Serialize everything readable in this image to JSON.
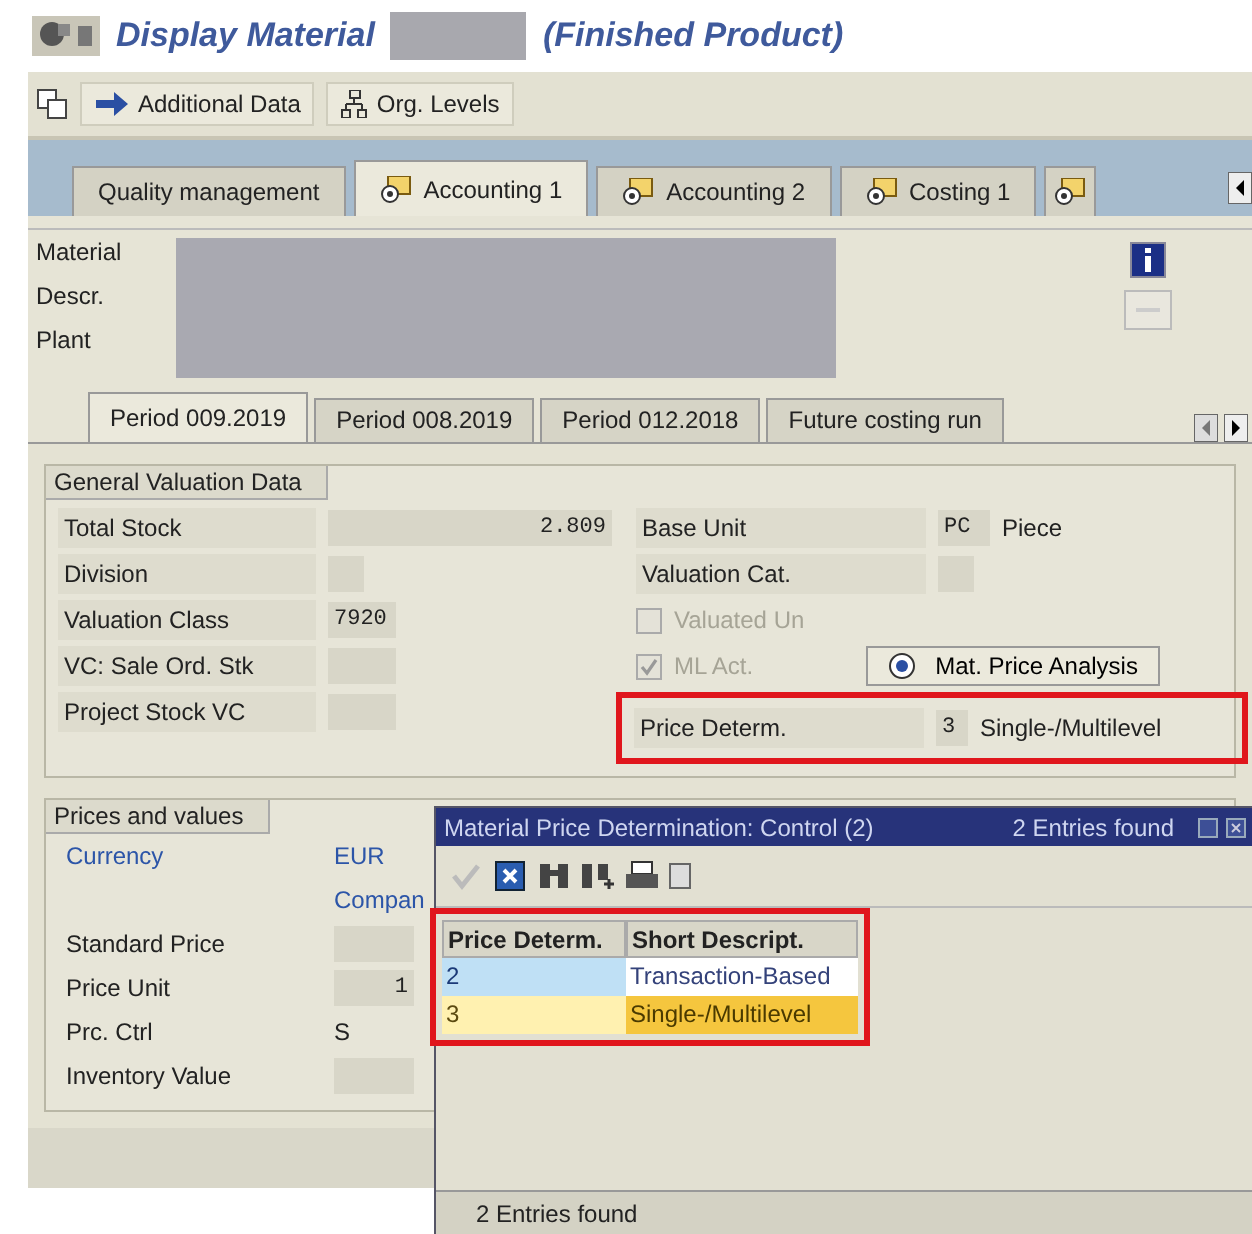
{
  "window": {
    "title_start": "Display Material",
    "title_end": "(Finished Product)"
  },
  "toolbar": {
    "buttons": [
      "Additional Data",
      "Org. Levels"
    ]
  },
  "tabs": [
    {
      "label": "Quality management",
      "selected": false,
      "icon": false
    },
    {
      "label": "Accounting 1",
      "selected": true,
      "icon": true
    },
    {
      "label": "Accounting 2",
      "selected": false,
      "icon": true
    },
    {
      "label": "Costing 1",
      "selected": false,
      "icon": true
    }
  ],
  "header": {
    "labels": [
      "Material",
      "Descr.",
      "Plant"
    ]
  },
  "period_tabs": [
    {
      "label": "Period 009.2019",
      "selected": true
    },
    {
      "label": "Period 008.2019",
      "selected": false
    },
    {
      "label": "Period 012.2018",
      "selected": false
    },
    {
      "label": "Future costing run",
      "selected": false
    }
  ],
  "general_valuation": {
    "title": "General Valuation Data",
    "left": [
      {
        "label": "Total Stock",
        "kind": "amount",
        "value": "2.809"
      },
      {
        "label": "Division",
        "kind": "code"
      },
      {
        "label": "Valuation Class",
        "kind": "wide_code",
        "value": "7920"
      },
      {
        "label": "VC: Sale Ord. Stk",
        "kind": "wide_code"
      },
      {
        "label": "Project Stock VC",
        "kind": "wide_code"
      }
    ],
    "base_unit": {
      "label": "Base Unit",
      "code": "PC",
      "text": "Piece"
    },
    "valuation_cat": {
      "label": "Valuation Cat."
    },
    "checkboxes": [
      {
        "label": "Valuated Un",
        "checked": false,
        "disabled": true
      },
      {
        "label": "ML Act.",
        "checked": true,
        "disabled": true
      }
    ],
    "analysis_button": "Mat. Price Analysis",
    "price_determ": {
      "label": "Price Determ.",
      "code": "3",
      "text": "Single-/Multilevel",
      "highlighted": true
    }
  },
  "prices": {
    "title": "Prices and values",
    "rows": [
      {
        "kind": "link",
        "label": "Currency",
        "value": "EUR"
      },
      {
        "kind": "link",
        "value": "Compan"
      },
      {
        "kind": "field",
        "label": "Standard Price"
      },
      {
        "kind": "field",
        "label": "Price Unit",
        "value": "1"
      },
      {
        "kind": "plain",
        "label": "Prc. Ctrl",
        "value": "S"
      },
      {
        "kind": "field",
        "label": "Inventory Value"
      }
    ]
  },
  "popup": {
    "title": "Material Price Determination: Control (2)",
    "title_count": "2 Entries found",
    "columns": [
      "Price Determ.",
      "Short Descript."
    ],
    "highlighted": true,
    "rows": [
      {
        "cells": [
          "2",
          "Transaction-Based"
        ],
        "selected": false
      },
      {
        "cells": [
          "3",
          "Single-/Multilevel"
        ],
        "selected": true
      }
    ],
    "status": "2 Entries found"
  }
}
